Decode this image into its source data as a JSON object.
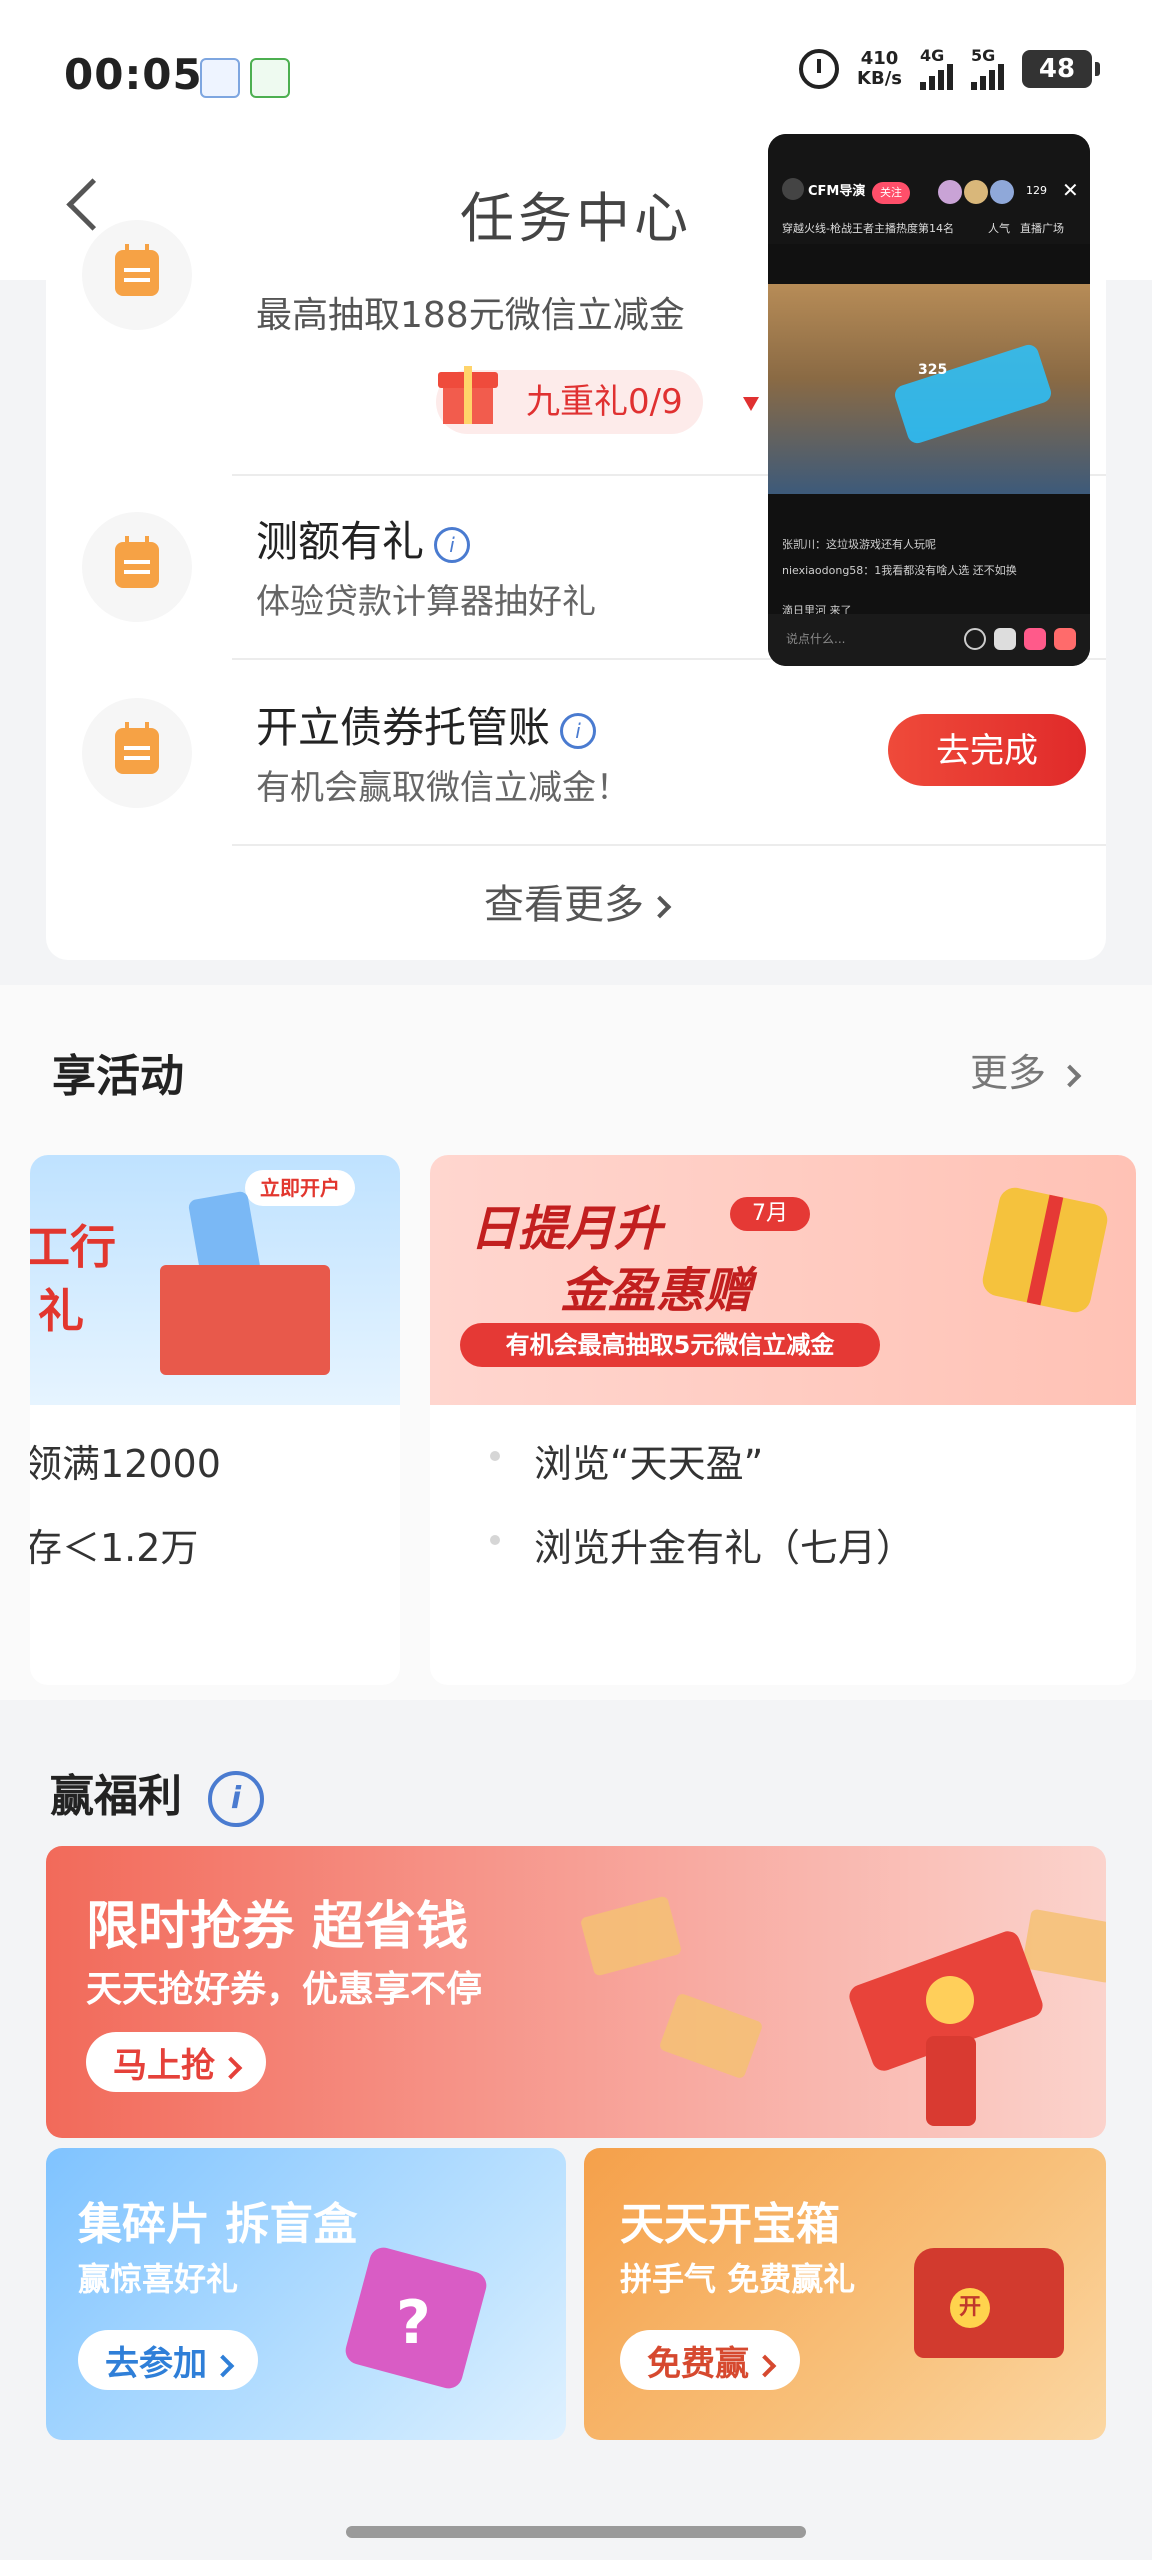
{
  "status_bar": {
    "time": "00:05",
    "net_speed_value": "410",
    "net_speed_unit": "KB/s",
    "sim1_label": "4G",
    "sim2_label": "5G",
    "battery": "48"
  },
  "header": {
    "title": "任务中心"
  },
  "tasks": [
    {
      "subtitle": "最高抽取188元微信立减金",
      "gift_label": "九重礼0/9"
    },
    {
      "title": "测额有礼",
      "subtitle": "体验贷款计算器抽好礼"
    },
    {
      "title": "开立债券托管账",
      "subtitle": "有机会赢取微信立减金！",
      "button": "去完成"
    }
  ],
  "task_more": "查看更多",
  "activities": {
    "title": "享活动",
    "more": "更多",
    "left_card": {
      "banner_text_1": "工行",
      "banner_text_2": "礼",
      "banner_tag": "立即开户",
      "line1": "领满12000",
      "line2": "存＜1.2万"
    },
    "right_card": {
      "banner_title_1": "日提月升",
      "banner_tag": "7月",
      "banner_title_2": "金盈惠赠",
      "banner_strip": "有机会最高抽取5元微信立减金",
      "line1": "浏览“天天盈”",
      "line2": "浏览升金有礼（七月）"
    }
  },
  "benefits": {
    "title": "赢福利",
    "promo_main": {
      "heading": "限时抢券 超省钱",
      "sub": "天天抢好券，优惠享不停",
      "button": "马上抢"
    },
    "promo_left": {
      "heading": "集碎片 拆盲盒",
      "sub": "赢惊喜好礼",
      "button": "去参加"
    },
    "promo_right": {
      "heading": "天天开宝箱",
      "sub": "拼手气 免费赢礼",
      "button": "免费赢",
      "chest_label": "开"
    }
  },
  "pip": {
    "streamer": "CFM导演",
    "follow": "关注",
    "viewers": "129",
    "rank_text": "穿越火线-枪战王者主播热度第14名",
    "popularity": "人气",
    "square": "直播广场",
    "score": "325",
    "chat": [
      "张凯川：这垃圾游戏还有人玩呢",
      "niexiaodong58：1我看都没有啥人选 还不如换",
      "滴日里河 来了"
    ],
    "input_placeholder": "说点什么..."
  },
  "colors": {
    "accent_red": "#e53935",
    "task_icon_orange": "#f6a245",
    "info_blue": "#4a7bd0"
  },
  "icons": {
    "back": "chevron-left-icon",
    "alarm": "alarm-clock-icon",
    "task": "calendar-icon",
    "info": "info-icon",
    "gift": "gift-icon"
  }
}
